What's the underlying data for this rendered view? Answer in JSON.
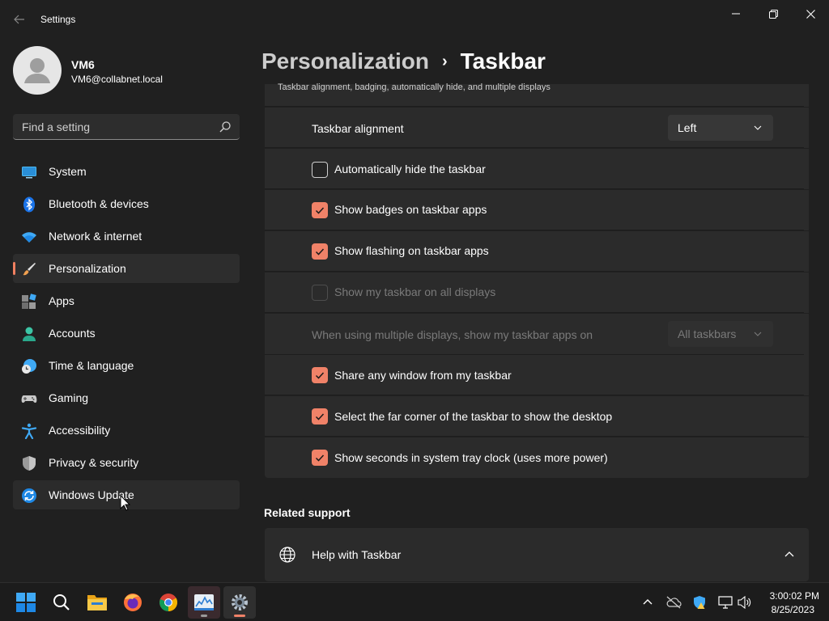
{
  "window": {
    "title": "Settings"
  },
  "profile": {
    "name": "VM6",
    "email": "VM6@collabnet.local"
  },
  "search": {
    "placeholder": "Find a setting"
  },
  "sidebar": {
    "items": [
      {
        "label": "System",
        "icon": "system-icon"
      },
      {
        "label": "Bluetooth & devices",
        "icon": "bluetooth-icon"
      },
      {
        "label": "Network & internet",
        "icon": "wifi-icon"
      },
      {
        "label": "Personalization",
        "icon": "brush-icon",
        "selected": true
      },
      {
        "label": "Apps",
        "icon": "apps-icon"
      },
      {
        "label": "Accounts",
        "icon": "person-icon"
      },
      {
        "label": "Time & language",
        "icon": "clock-globe-icon"
      },
      {
        "label": "Gaming",
        "icon": "gamepad-icon"
      },
      {
        "label": "Accessibility",
        "icon": "accessibility-icon"
      },
      {
        "label": "Privacy & security",
        "icon": "shield-icon"
      },
      {
        "label": "Windows Update",
        "icon": "update-icon"
      }
    ]
  },
  "breadcrumb": {
    "parent": "Personalization",
    "separator": "›",
    "current": "Taskbar"
  },
  "behaviors": {
    "subtitle": "Taskbar alignment, badging, automatically hide, and multiple displays",
    "alignment_label": "Taskbar alignment",
    "alignment_value": "Left",
    "auto_hide": {
      "label": "Automatically hide the taskbar",
      "checked": false
    },
    "badges": {
      "label": "Show badges on taskbar apps",
      "checked": true
    },
    "flashing": {
      "label": "Show flashing on taskbar apps",
      "checked": true
    },
    "all_displays": {
      "label": "Show my taskbar on all displays",
      "checked": false,
      "disabled": true
    },
    "multi_display_label": "When using multiple displays, show my taskbar apps on",
    "multi_display_value": "All taskbars",
    "share_window": {
      "label": "Share any window from my taskbar",
      "checked": true
    },
    "far_corner": {
      "label": "Select the far corner of the taskbar to show the desktop",
      "checked": true
    },
    "seconds": {
      "label": "Show seconds in system tray clock (uses more power)",
      "checked": true
    }
  },
  "related": {
    "title": "Related support",
    "help_label": "Help with Taskbar"
  },
  "taskbar": {
    "apps": [
      "windows-start-icon",
      "search-icon",
      "file-explorer-icon",
      "firefox-icon",
      "chrome-icon",
      "task-manager-icon",
      "settings-icon"
    ],
    "time": "3:00:02 PM",
    "date": "8/25/2023"
  },
  "colors": {
    "accent": "#f08268",
    "background": "#202020",
    "card": "#2b2b2b"
  }
}
